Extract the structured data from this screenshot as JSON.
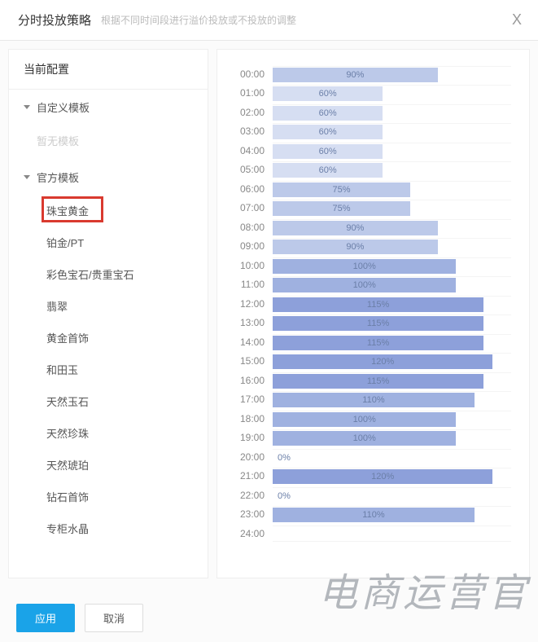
{
  "header": {
    "title": "分时投放策略",
    "subtitle": "根据不同时间段进行溢价投放或不投放的调整",
    "close": "X"
  },
  "sidebar": {
    "current_config_label": "当前配置",
    "custom_group_label": "自定义模板",
    "custom_empty": "暂无模板",
    "official_group_label": "官方模板",
    "official_items": [
      "珠宝黄金",
      "铂金/PT",
      "彩色宝石/贵重宝石",
      "翡翠",
      "黄金首饰",
      "和田玉",
      "天然玉石",
      "天然珍珠",
      "天然琥珀",
      "钻石首饰",
      "专柜水晶"
    ],
    "selected_index": 0
  },
  "chart_data": {
    "type": "bar",
    "title": "",
    "xlabel": "",
    "ylabel": "",
    "ylim": [
      0,
      130
    ],
    "categories": [
      "00:00",
      "01:00",
      "02:00",
      "03:00",
      "04:00",
      "05:00",
      "06:00",
      "07:00",
      "08:00",
      "09:00",
      "10:00",
      "11:00",
      "12:00",
      "13:00",
      "14:00",
      "15:00",
      "16:00",
      "17:00",
      "18:00",
      "19:00",
      "20:00",
      "21:00",
      "22:00",
      "23:00",
      "24:00"
    ],
    "values": [
      90,
      60,
      60,
      60,
      60,
      60,
      75,
      75,
      90,
      90,
      100,
      100,
      115,
      115,
      115,
      120,
      115,
      110,
      100,
      100,
      0,
      120,
      0,
      110,
      null
    ],
    "value_suffix": "%",
    "colors": {
      "low": "#d6def2",
      "mid": "#bcc9e9",
      "high": "#9fb1e0",
      "peak": "#8da0da"
    }
  },
  "footer": {
    "apply_label": "应用",
    "cancel_label": "取消"
  },
  "watermark": "电商运营官"
}
